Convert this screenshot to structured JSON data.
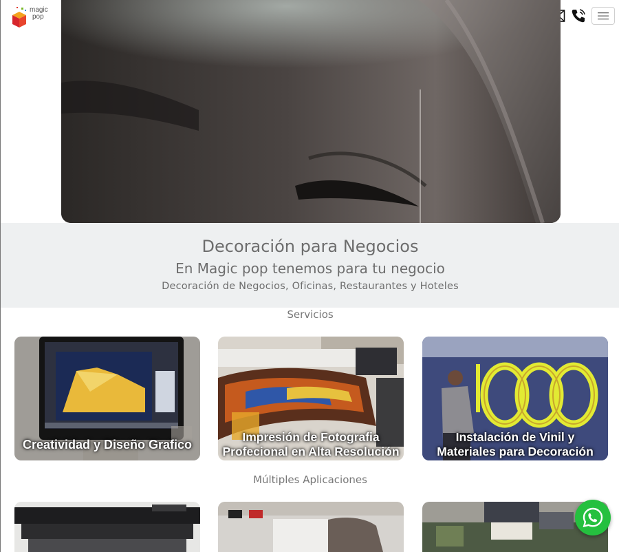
{
  "header": {
    "logo_line1": "magic",
    "logo_line2": "pop",
    "icons": [
      "mail-icon",
      "phone-icon",
      "hamburger-menu-icon"
    ]
  },
  "intro": {
    "title": "Decoración para Negocios",
    "subtitle": "En Magic pop tenemos para tu negocio",
    "description": "Decoración de Negocios, Oficinas, Restaurantes y Hoteles"
  },
  "services": {
    "heading": "Servicios",
    "cards": [
      {
        "caption": "Creatividad y Diseño Grafico"
      },
      {
        "caption": "Impresión de Fotografia Profecional en Alta Resolución"
      },
      {
        "caption": "Instalación de Vinil y Materiales para Decoración"
      }
    ]
  },
  "applications": {
    "heading": "Múltiples Aplicaciones"
  },
  "colors": {
    "band_bg": "#eef0f1",
    "whatsapp": "#25c03f",
    "text": "#6d6d6d"
  }
}
